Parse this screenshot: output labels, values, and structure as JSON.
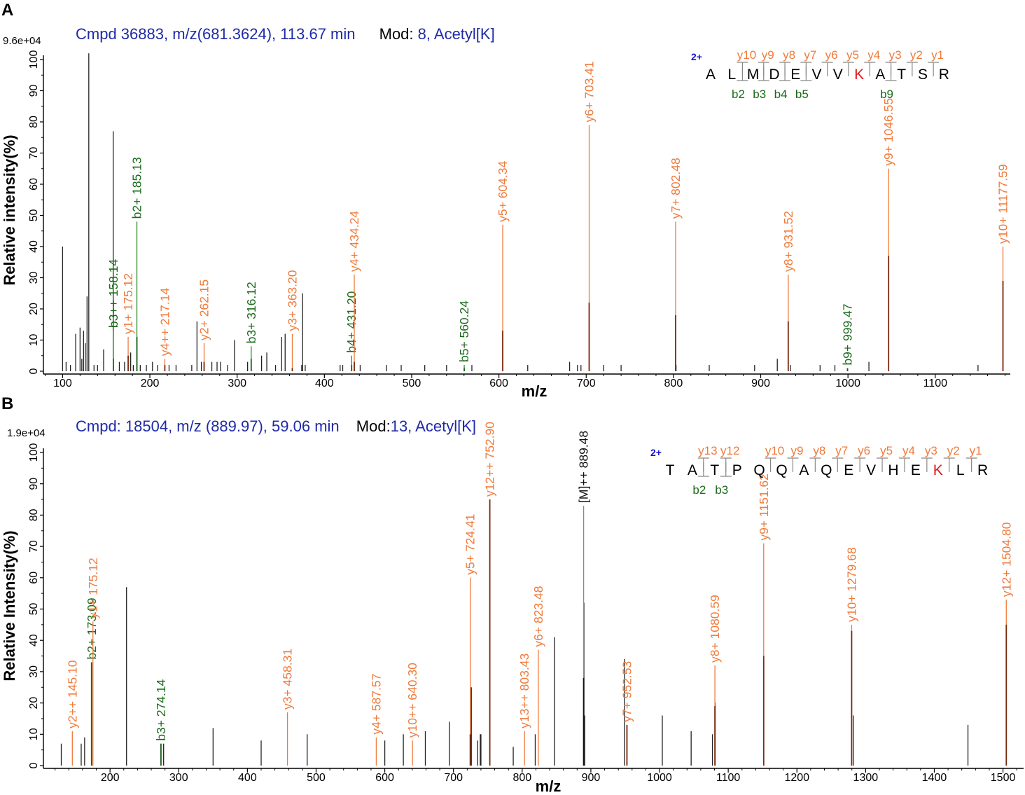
{
  "panels": [
    {
      "letter": "A",
      "scale_label": "9.6e+04",
      "header": {
        "cmpd": "Cmpd 36883, m/z(681.3624), 113.67 min",
        "mod_prefix": "Mod: ",
        "mod_value": "8, Acetyl[K]"
      },
      "sequence": {
        "charge": "2+",
        "residues": [
          "A",
          "L",
          "M",
          "D",
          "E",
          "V",
          "V",
          "K",
          "A",
          "T",
          "S",
          "R"
        ],
        "modified_index": 7,
        "y_labels": [
          "y10",
          "y9",
          "y8",
          "y7",
          "y6",
          "y5",
          "y4",
          "y3",
          "y2",
          "y1"
        ],
        "b_labels": [
          "b2",
          "b3",
          "b4",
          "b5",
          "b9"
        ]
      }
    },
    {
      "letter": "B",
      "scale_label": "1.9e+04",
      "header": {
        "cmpd": "Cmpd: 18504, m/z (889.97), 59.06 min",
        "mod_prefix": "Mod:",
        "mod_value": "13, Acetyl[K]"
      },
      "sequence": {
        "charge": "2+",
        "residues": [
          "T",
          "A",
          "T",
          "P",
          "Q",
          "Q",
          "A",
          "Q",
          "E",
          "V",
          "H",
          "E",
          "K",
          "L",
          "R"
        ],
        "modified_index": 12,
        "y_labels": [
          "y13",
          "y12",
          "y10",
          "y9",
          "y8",
          "y7",
          "y6",
          "y5",
          "y4",
          "y3",
          "y2",
          "y1"
        ],
        "b_labels": [
          "b2",
          "b3"
        ]
      }
    }
  ],
  "colors": {
    "y_ion": "#f07a3a",
    "b_ion": "#2e8b2e",
    "b_label": "#1a6b1a",
    "precursor": "#333333",
    "other_peak": "#222222",
    "header": "#1f2aa8",
    "modified": "#e0191b",
    "charge": "#1414cc"
  },
  "chart_data": [
    {
      "type": "bar",
      "title": "Cmpd 36883, m/z(681.3624), 113.67 min",
      "xlabel": "m/z",
      "ylabel": "Relative intensity(%)",
      "xlim": [
        78,
        1186
      ],
      "ylim": [
        0,
        100
      ],
      "xticks": [
        100,
        200,
        300,
        400,
        500,
        600,
        700,
        800,
        900,
        1000,
        1100
      ],
      "yticks": [
        0,
        10,
        20,
        30,
        40,
        50,
        60,
        70,
        80,
        90,
        100
      ],
      "annotated_peaks": [
        {
          "mz": 158.14,
          "line": 13,
          "head": 4,
          "label": "b3++ 158.14",
          "ion": "b"
        },
        {
          "mz": 175.12,
          "line": 11,
          "head": 5,
          "label": "y1+ 175.12",
          "ion": "y"
        },
        {
          "mz": 185.13,
          "line": 48,
          "head": 11,
          "label": "b2+ 185.13",
          "ion": "b"
        },
        {
          "mz": 217.14,
          "line": 4,
          "head": 2,
          "label": "y4++ 217.14",
          "ion": "y"
        },
        {
          "mz": 262.15,
          "line": 9,
          "head": 3,
          "label": "y2+ 262.15",
          "ion": "y"
        },
        {
          "mz": 316.12,
          "line": 8,
          "head": 4,
          "label": "b3+ 316.12",
          "ion": "b"
        },
        {
          "mz": 363.2,
          "line": 12,
          "head": 1,
          "label": "y3+ 363.20",
          "ion": "y"
        },
        {
          "mz": 431.2,
          "line": 5,
          "head": 2,
          "label": "b4+ 431.20",
          "ion": "b"
        },
        {
          "mz": 434.24,
          "line": 31,
          "head": 3,
          "label": "y4+ 434.24",
          "ion": "y"
        },
        {
          "mz": 560.24,
          "line": 2,
          "head": 1,
          "label": "b5+ 560.24",
          "ion": "b"
        },
        {
          "mz": 604.34,
          "line": 47,
          "head": 13,
          "label": "y5+ 604.34",
          "ion": "y"
        },
        {
          "mz": 703.41,
          "line": 79,
          "head": 22,
          "label": "y6+ 703.41",
          "ion": "y"
        },
        {
          "mz": 802.48,
          "line": 48,
          "head": 18,
          "label": "y7+ 802.48",
          "ion": "y"
        },
        {
          "mz": 931.52,
          "line": 31,
          "head": 16,
          "label": "y8+ 931.52",
          "ion": "y"
        },
        {
          "mz": 999.47,
          "line": 1,
          "head": 1,
          "label": "b9+ 999.47",
          "ion": "b"
        },
        {
          "mz": 1046.55,
          "line": 65,
          "head": 37,
          "label": "y9+ 1046.55",
          "ion": "y"
        },
        {
          "mz": 1177.59,
          "line": 40,
          "head": 29,
          "label": "y10+ 11177.59",
          "ion": "y"
        }
      ],
      "other_peaks": [
        [
          100,
          40
        ],
        [
          104,
          3
        ],
        [
          109,
          2
        ],
        [
          115,
          12
        ],
        [
          120,
          14
        ],
        [
          122,
          4
        ],
        [
          124,
          13
        ],
        [
          126,
          9
        ],
        [
          128,
          24
        ],
        [
          130,
          102
        ],
        [
          136,
          2
        ],
        [
          140,
          2
        ],
        [
          147,
          7
        ],
        [
          158,
          77
        ],
        [
          165,
          3
        ],
        [
          171,
          3
        ],
        [
          178,
          6
        ],
        [
          181,
          2
        ],
        [
          189,
          2
        ],
        [
          196,
          2
        ],
        [
          203,
          3
        ],
        [
          209,
          2
        ],
        [
          222,
          2
        ],
        [
          230,
          2
        ],
        [
          248,
          2
        ],
        [
          254,
          16
        ],
        [
          259,
          3
        ],
        [
          271,
          3
        ],
        [
          277,
          3
        ],
        [
          281,
          3
        ],
        [
          289,
          2
        ],
        [
          297,
          10
        ],
        [
          312,
          3
        ],
        [
          328,
          5
        ],
        [
          334,
          6
        ],
        [
          344,
          2
        ],
        [
          351,
          11
        ],
        [
          355,
          12
        ],
        [
          374,
          2
        ],
        [
          375,
          25
        ],
        [
          378,
          2
        ],
        [
          418,
          2
        ],
        [
          421,
          2
        ],
        [
          441,
          2
        ],
        [
          471,
          2
        ],
        [
          488,
          2
        ],
        [
          515,
          2
        ],
        [
          540,
          2
        ],
        [
          569,
          2
        ],
        [
          633,
          2
        ],
        [
          681,
          3
        ],
        [
          690,
          2
        ],
        [
          694,
          2
        ],
        [
          720,
          2
        ],
        [
          740,
          2
        ],
        [
          803,
          2
        ],
        [
          841,
          2
        ],
        [
          893,
          2
        ],
        [
          919,
          4
        ],
        [
          934,
          2
        ],
        [
          968,
          2
        ],
        [
          985,
          2
        ],
        [
          1024,
          3
        ],
        [
          1149,
          2
        ]
      ]
    },
    {
      "type": "bar",
      "title": "Cmpd: 18504, m/z (889.97), 59.06 min",
      "xlabel": "m/z",
      "ylabel": "Relative Intensity(%)",
      "xlim": [
        103,
        1530
      ],
      "ylim": [
        0,
        100
      ],
      "xticks": [
        200,
        300,
        400,
        500,
        600,
        700,
        800,
        900,
        1000,
        1100,
        1200,
        1300,
        1400,
        1500
      ],
      "yticks": [
        0,
        10,
        20,
        30,
        40,
        50,
        60,
        70,
        80,
        90,
        100
      ],
      "annotated_peaks": [
        {
          "mz": 145.1,
          "line": 11,
          "head": 0,
          "label": "y2++ 145.10",
          "ion": "y"
        },
        {
          "mz": 173.09,
          "line": 33,
          "head": 33,
          "label": "b2+ 173.09",
          "ion": "b"
        },
        {
          "mz": 175.12,
          "line": 46,
          "head": 0,
          "label": "y1+ 175.12",
          "ion": "y"
        },
        {
          "mz": 274.14,
          "line": 7,
          "head": 7,
          "label": "b3+ 274.14",
          "ion": "b"
        },
        {
          "mz": 458.31,
          "line": 17,
          "head": 0,
          "label": "y3+ 458.31",
          "ion": "y"
        },
        {
          "mz": 587.57,
          "line": 9,
          "head": 0,
          "label": "y4+ 587.57",
          "ion": "y"
        },
        {
          "mz": 640.3,
          "line": 8,
          "head": 0,
          "label": "y10++ 640.30",
          "ion": "y"
        },
        {
          "mz": 724.41,
          "line": 60,
          "head": 10,
          "label": "y5+ 724.41",
          "ion": "y"
        },
        {
          "mz": 752.9,
          "line": 85,
          "head": 85,
          "label": "y12++ 752.90",
          "ion": "y"
        },
        {
          "mz": 803.43,
          "line": 11,
          "head": 0,
          "label": "y13++ 803.43",
          "ion": "y"
        },
        {
          "mz": 823.48,
          "line": 37,
          "head": 0,
          "label": "y6+ 823.48",
          "ion": "y"
        },
        {
          "mz": 889.48,
          "line": 83,
          "head": 28,
          "label": "[M]++ 889.48",
          "ion": "precursor"
        },
        {
          "mz": 952.53,
          "line": 13,
          "head": 13,
          "label": "y7+ 952.53",
          "ion": "y"
        },
        {
          "mz": 1080.59,
          "line": 32,
          "head": 19,
          "label": "y8+ 1080.59",
          "ion": "y"
        },
        {
          "mz": 1151.62,
          "line": 71,
          "head": 35,
          "label": "y9+ 1151.62",
          "ion": "y"
        },
        {
          "mz": 1279.68,
          "line": 45,
          "head": 43,
          "label": "y10+ 1279.68",
          "ion": "y"
        },
        {
          "mz": 1504.8,
          "line": 53,
          "head": 45,
          "label": "y12+ 1504.80",
          "ion": "y"
        }
      ],
      "other_peaks": [
        [
          129,
          7
        ],
        [
          158,
          7
        ],
        [
          163,
          9
        ],
        [
          224,
          57
        ],
        [
          278,
          7
        ],
        [
          350,
          12
        ],
        [
          420,
          8
        ],
        [
          487,
          10
        ],
        [
          600,
          8
        ],
        [
          627,
          10
        ],
        [
          659,
          11
        ],
        [
          694,
          14
        ],
        [
          726,
          25
        ],
        [
          735,
          8
        ],
        [
          739,
          10
        ],
        [
          740,
          10
        ],
        [
          787,
          6
        ],
        [
          819,
          10
        ],
        [
          847,
          41
        ],
        [
          890,
          52
        ],
        [
          891,
          16
        ],
        [
          949,
          34
        ],
        [
          1004,
          16
        ],
        [
          1046,
          11
        ],
        [
          1077,
          10
        ],
        [
          1081,
          20
        ],
        [
          1282,
          16
        ],
        [
          1449,
          13
        ]
      ]
    }
  ]
}
